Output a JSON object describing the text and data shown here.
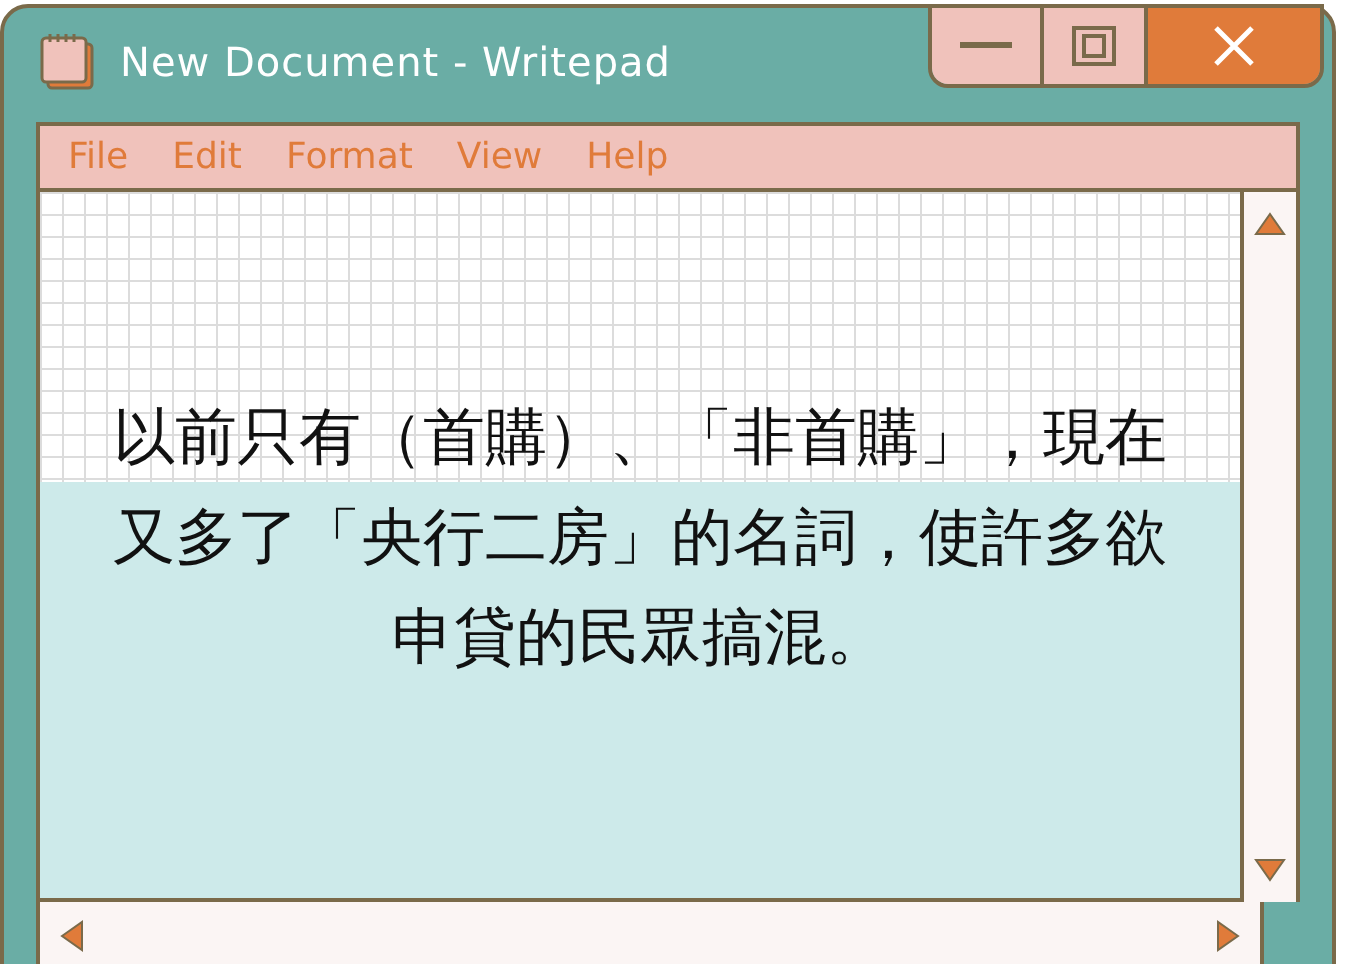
{
  "window": {
    "title": "New Document - Writepad"
  },
  "menu": [
    {
      "label": "File"
    },
    {
      "label": "Edit"
    },
    {
      "label": "Format"
    },
    {
      "label": "View"
    },
    {
      "label": "Help"
    }
  ],
  "document": {
    "text": "以前只有（首購）、「非首購」，現在又多了「央行二房」的名詞，使許多欲申貸的民眾搞混。"
  }
}
